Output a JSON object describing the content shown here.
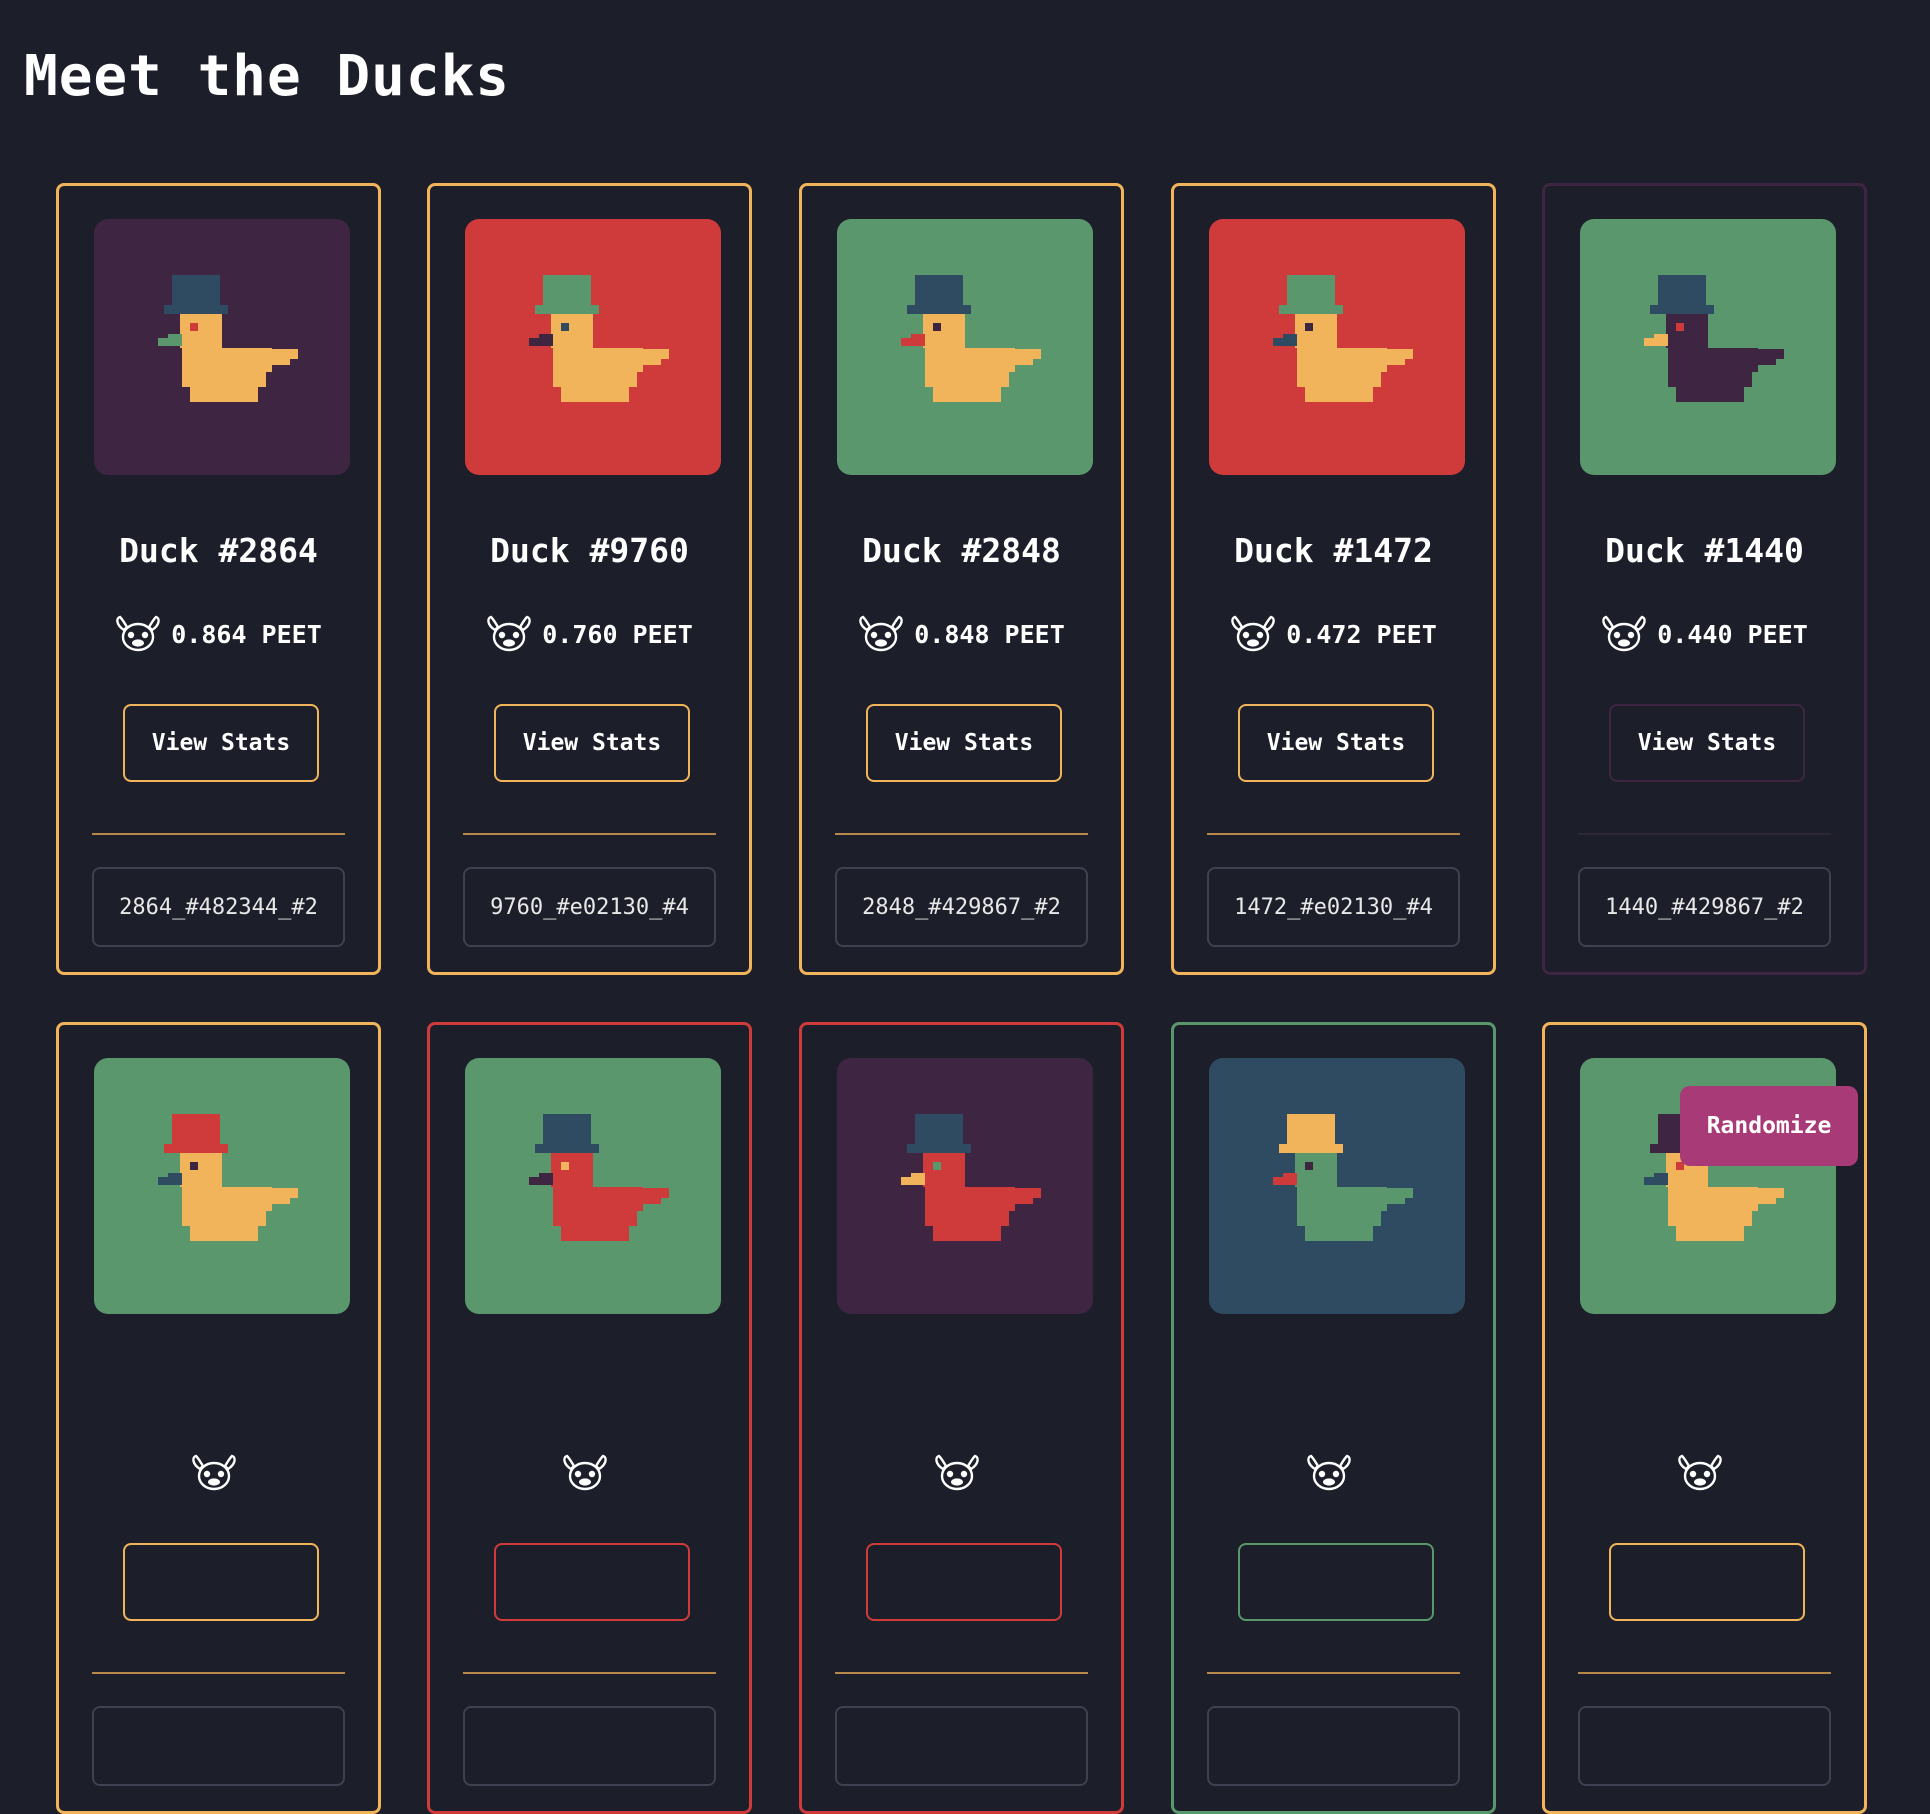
{
  "page": {
    "title": "Meet the Ducks"
  },
  "colors": {
    "background": "#1c1f2a",
    "gold": "#f2b45a",
    "plum": "#3e2541",
    "red": "#cf3b3a",
    "green": "#5a976c",
    "slate": "#2e4b62",
    "button_accent": "#a83a78"
  },
  "currency": {
    "icon": "duck-face-icon",
    "unit": "PEET"
  },
  "cards": [
    {
      "name": "Duck #2864",
      "price": "0.864 PEET",
      "button": "View Stats",
      "code": "2864_#482344_#2",
      "border": "#f2b45a",
      "bg": "#3e2541",
      "hat": "#2e4b62",
      "body": "#f2b45a",
      "beak": "#5a976c",
      "eye": "#cf3b3a"
    },
    {
      "name": "Duck #9760",
      "price": "0.760 PEET",
      "button": "View Stats",
      "code": "9760_#e02130_#4",
      "border": "#f2b45a",
      "bg": "#cf3b3a",
      "hat": "#5a976c",
      "body": "#f2b45a",
      "beak": "#3e2541",
      "eye": "#2e4b62"
    },
    {
      "name": "Duck #2848",
      "price": "0.848 PEET",
      "button": "View Stats",
      "code": "2848_#429867_#2",
      "border": "#f2b45a",
      "bg": "#5a976c",
      "hat": "#2e4b62",
      "body": "#f2b45a",
      "beak": "#cf3b3a",
      "eye": "#3e2541"
    },
    {
      "name": "Duck #1472",
      "price": "0.472 PEET",
      "button": "View Stats",
      "code": "1472_#e02130_#4",
      "border": "#f2b45a",
      "bg": "#cf3b3a",
      "hat": "#5a976c",
      "body": "#f2b45a",
      "beak": "#2e4b62",
      "eye": "#3e2541"
    },
    {
      "name": "Duck #1440",
      "price": "0.440 PEET",
      "button": "View Stats",
      "code": "1440_#429867_#2",
      "border": "#3e2541",
      "bg": "#5a976c",
      "hat": "#2e4b62",
      "body": "#3e2541",
      "beak": "#f2b45a",
      "eye": "#cf3b3a"
    },
    {
      "name": "",
      "price": "",
      "button": "",
      "code": "",
      "border": "#f2b45a",
      "bg": "#5a976c",
      "hat": "#cf3b3a",
      "body": "#f2b45a",
      "beak": "#2e4b62",
      "eye": "#3e2541"
    },
    {
      "name": "",
      "price": "",
      "button": "",
      "code": "",
      "border": "#cf3b3a",
      "bg": "#5a976c",
      "hat": "#2e4b62",
      "body": "#cf3b3a",
      "beak": "#3e2541",
      "eye": "#f2b45a"
    },
    {
      "name": "",
      "price": "",
      "button": "",
      "code": "",
      "border": "#cf3b3a",
      "bg": "#3e2541",
      "hat": "#2e4b62",
      "body": "#cf3b3a",
      "beak": "#f2b45a",
      "eye": "#5a976c"
    },
    {
      "name": "",
      "price": "",
      "button": "",
      "code": "",
      "border": "#5a976c",
      "bg": "#2e4b62",
      "hat": "#f2b45a",
      "body": "#5a976c",
      "beak": "#cf3b3a",
      "eye": "#3e2541"
    },
    {
      "name": "",
      "price": "",
      "button": "",
      "code": "",
      "border": "#f2b45a",
      "bg": "#5a976c",
      "hat": "#3e2541",
      "body": "#f2b45a",
      "beak": "#2e4b62",
      "eye": "#cf3b3a"
    }
  ],
  "actions": {
    "randomize": "Randomize"
  }
}
